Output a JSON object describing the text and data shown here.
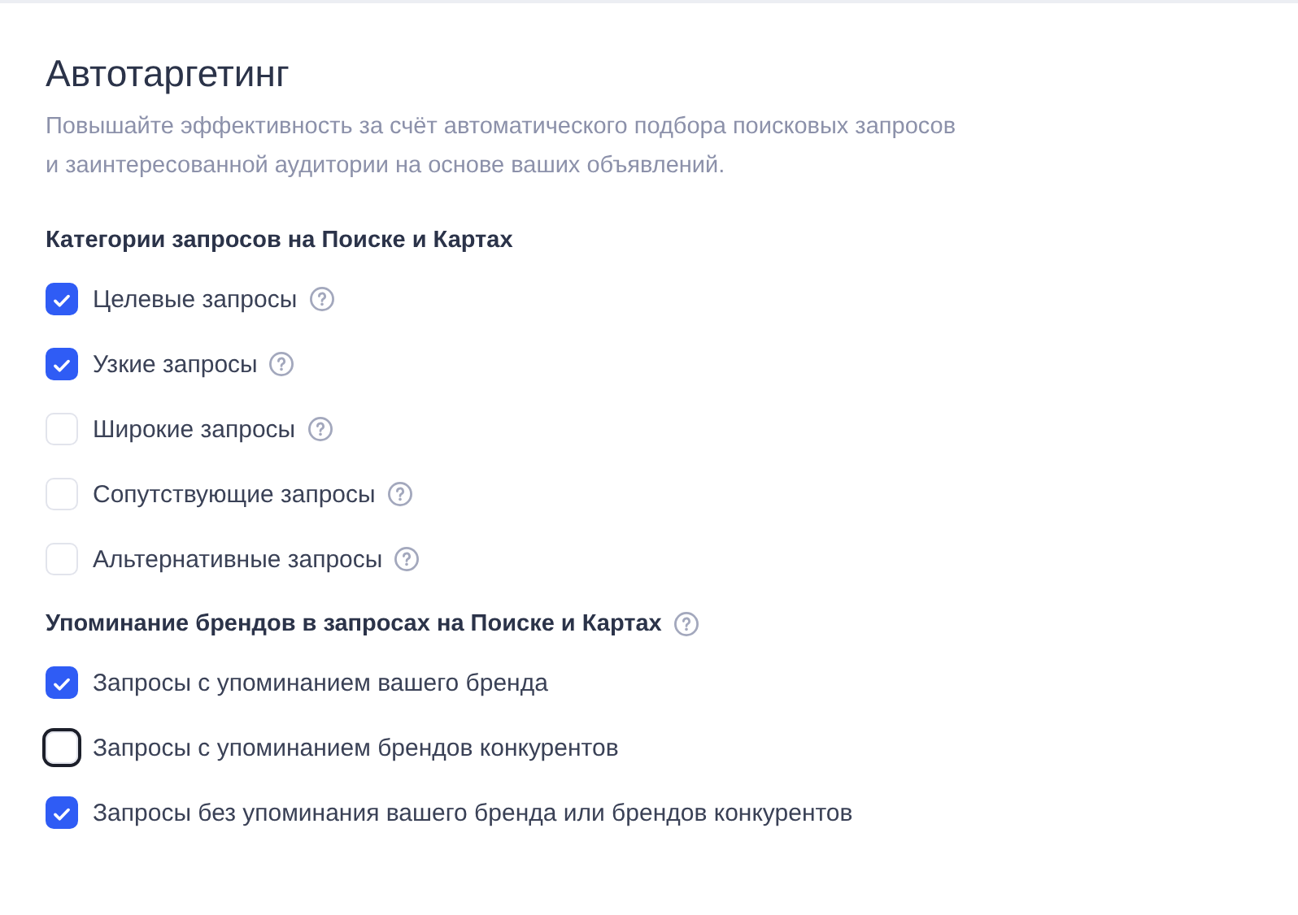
{
  "title": "Автотаргетинг",
  "description": [
    "Повышайте эффективность за счёт автоматического подбора поисковых запросов",
    "и заинтересованной аудитории на основе ваших объявлений."
  ],
  "sections": [
    {
      "heading": "Категории запросов на Поиске и Картах",
      "help": false,
      "options": [
        {
          "label": "Целевые запросы",
          "checked": true,
          "focused": false,
          "help": true
        },
        {
          "label": "Узкие запросы",
          "checked": true,
          "focused": false,
          "help": true
        },
        {
          "label": "Широкие запросы",
          "checked": false,
          "focused": false,
          "help": true
        },
        {
          "label": "Сопутствующие запросы",
          "checked": false,
          "focused": false,
          "help": true
        },
        {
          "label": "Альтернативные запросы",
          "checked": false,
          "focused": false,
          "help": true
        }
      ]
    },
    {
      "heading": "Упоминание брендов в запросах на Поиске и Картах",
      "help": true,
      "options": [
        {
          "label": "Запросы с упоминанием вашего бренда",
          "checked": true,
          "focused": false,
          "help": false
        },
        {
          "label": "Запросы с упоминанием брендов конкурентов",
          "checked": false,
          "focused": true,
          "help": false
        },
        {
          "label": "Запросы без упоминания вашего бренда или брендов конкурентов",
          "checked": true,
          "focused": false,
          "help": false
        }
      ]
    }
  ]
}
